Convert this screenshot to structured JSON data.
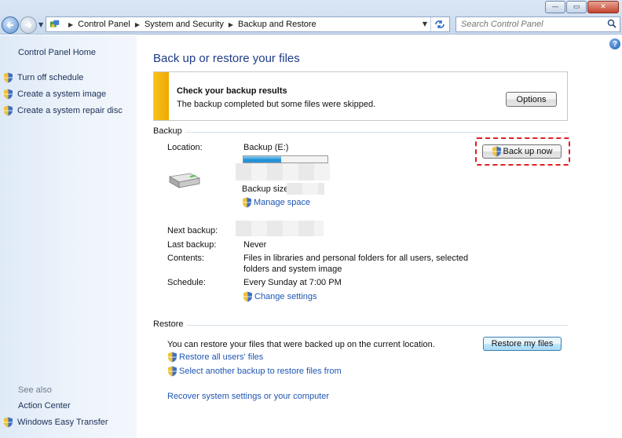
{
  "window": {
    "minimize_glyph": "—",
    "maximize_glyph": "▭",
    "close_glyph": "✕"
  },
  "address_bar": {
    "crumbs": [
      "Control Panel",
      "System and Security",
      "Backup and Restore"
    ],
    "search_placeholder": "Search Control Panel"
  },
  "sidebar": {
    "home": "Control Panel Home",
    "tasks": [
      {
        "label": "Turn off schedule",
        "icon": "shield-icon"
      },
      {
        "label": "Create a system image",
        "icon": "shield-icon"
      },
      {
        "label": "Create a system repair disc",
        "icon": "shield-icon"
      }
    ],
    "see_also_heading": "See also",
    "see_also": [
      {
        "label": "Action Center"
      },
      {
        "label": "Windows Easy Transfer",
        "icon": "shield-icon"
      }
    ]
  },
  "main": {
    "help_glyph": "?",
    "title": "Back up or restore your files",
    "notice": {
      "title": "Check your backup results",
      "text": "The backup completed but some files were skipped.",
      "button": "Options"
    },
    "backup": {
      "heading": "Backup",
      "location_label": "Location:",
      "location_value": "Backup (E:)",
      "drive_usage_fraction": 0.45,
      "backup_size_label": "Backup size:",
      "manage_space": "Manage space",
      "back_up_now": "Back up now",
      "next_backup_label": "Next backup:",
      "last_backup_label": "Last backup:",
      "last_backup_value": "Never",
      "contents_label": "Contents:",
      "contents_value_line1": "Files in libraries and personal folders for all users, selected",
      "contents_value_line2": "folders and system image",
      "schedule_label": "Schedule:",
      "schedule_value": "Every Sunday at 7:00 PM",
      "change_settings": "Change settings"
    },
    "restore": {
      "heading": "Restore",
      "text": "You can restore your files that were backed up on the current location.",
      "restore_my_files": "Restore my files",
      "restore_all_users": "Restore all users' files",
      "select_another": "Select another backup to restore files from",
      "recover_system": "Recover system settings or your computer"
    }
  },
  "colors": {
    "link": "#1f56b3",
    "title": "#1e3b86",
    "notice_bar": "#f8c21a",
    "highlight": "#e02020"
  }
}
